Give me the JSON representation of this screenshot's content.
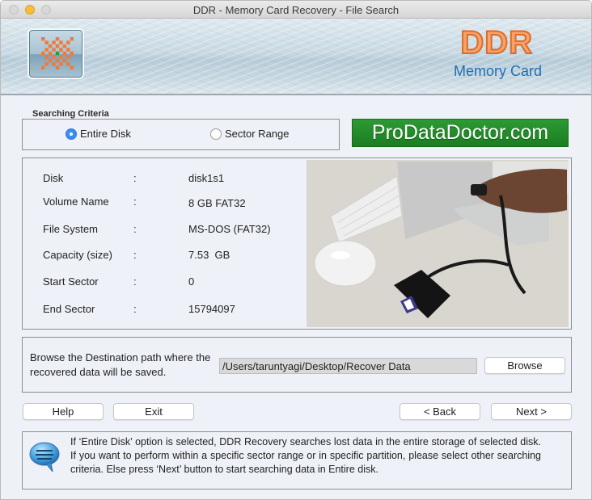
{
  "window": {
    "title": "DDR - Memory Card Recovery - File Search"
  },
  "banner": {
    "brand": "DDR",
    "subtitle": "Memory Card"
  },
  "search_criteria": {
    "legend": "Searching Criteria",
    "options": [
      {
        "label": "Entire Disk",
        "selected": true
      },
      {
        "label": "Sector Range",
        "selected": false
      }
    ]
  },
  "promo": {
    "text": "ProDataDoctor.com",
    "color": "#1f8a26"
  },
  "disk_info": {
    "rows": [
      {
        "label": "Disk",
        "value": "disk1s1"
      },
      {
        "label": "Volume Name",
        "value": "8 GB FAT32"
      },
      {
        "label": "File System",
        "value": "MS-DOS (FAT32)"
      },
      {
        "label": "Capacity (size)",
        "value": "7.53  GB"
      },
      {
        "label": "Start Sector",
        "value": "0"
      },
      {
        "label": "End Sector",
        "value": "15794097"
      }
    ],
    "separator": ":"
  },
  "destination": {
    "description": "Browse the Destination path where the recovered data will be saved.",
    "path": "/Users/taruntyagi/Desktop/Recover Data",
    "browse_label": "Browse"
  },
  "buttons": {
    "help": "Help",
    "exit": "Exit",
    "back": "< Back",
    "next": "Next >"
  },
  "tip": {
    "icon": "speech-bubble-icon",
    "text": "If ‘Entire Disk’ option is selected, DDR Recovery searches lost data in the entire storage of selected disk. If you want to perform within a specific sector range or in specific partition, please select other searching criteria. Else press ‘Next’ button to start searching data in Entire disk."
  }
}
